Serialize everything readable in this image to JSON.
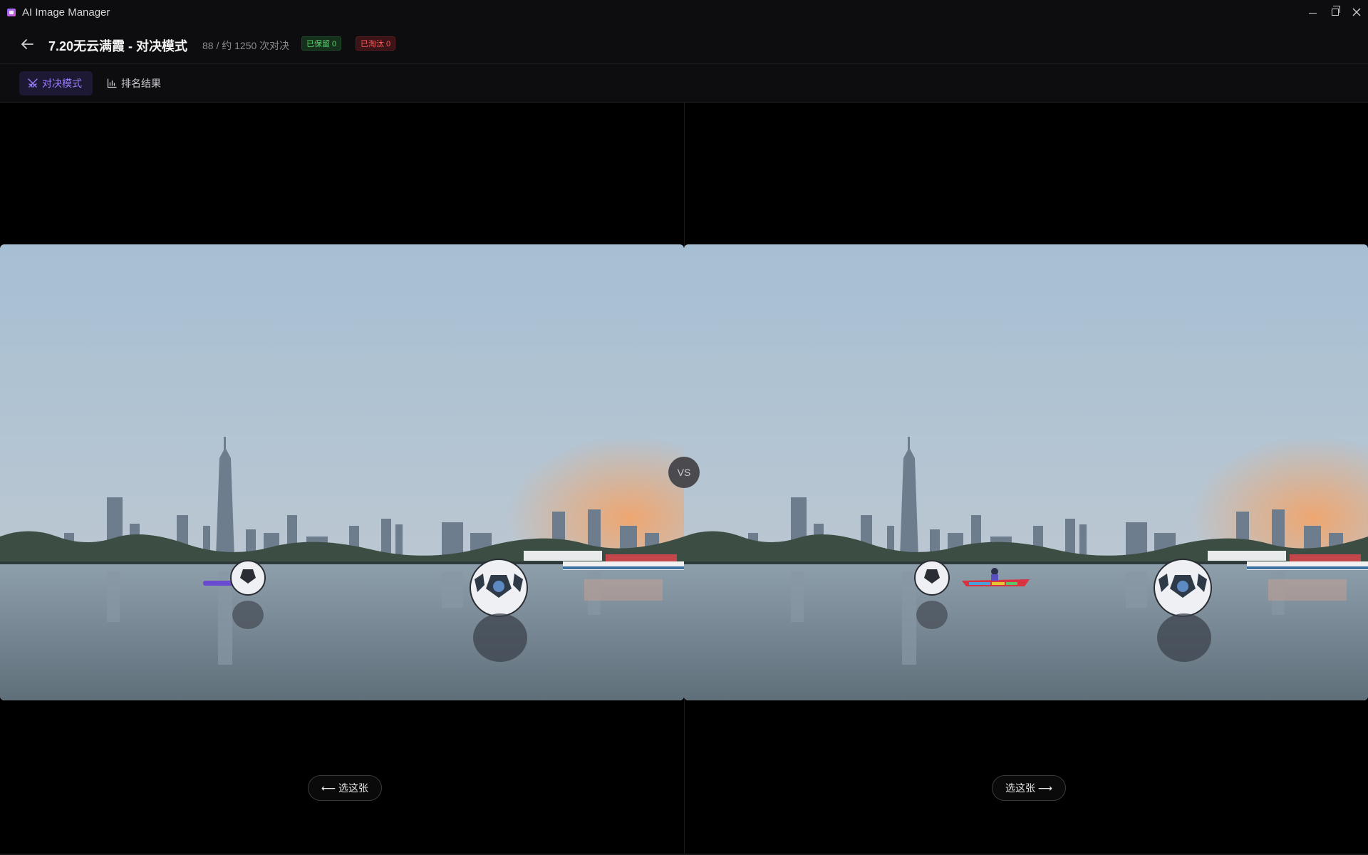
{
  "app": {
    "title": "AI Image Manager"
  },
  "window_controls": [
    "minimize-icon",
    "maximize-icon",
    "close-icon"
  ],
  "header": {
    "title": "7.20无云满霞 - 对决模式",
    "progress": "88 / 约 1250 次对决",
    "kept_badge": "已保留 0",
    "eliminated_badge": "已淘汰 0"
  },
  "tabs": [
    {
      "label": "对决模式",
      "icon": "swords-icon",
      "active": true
    },
    {
      "label": "排名结果",
      "icon": "bar-chart-icon",
      "active": false
    }
  ],
  "compare": {
    "vs_label": "VS",
    "left_button": "⟵ 选这张",
    "right_button": "选这张 ⟶"
  },
  "colors": {
    "accent": "#9b7dff",
    "kept_green": "#5bd46f",
    "eliminated_red": "#ff5b5b"
  }
}
